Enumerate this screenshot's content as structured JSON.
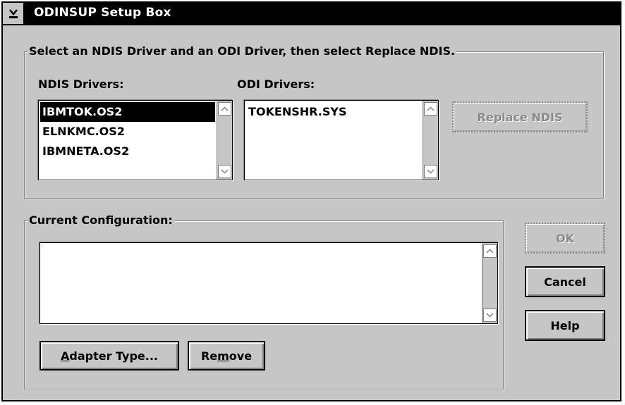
{
  "window": {
    "title": "ODINSUP Setup Box"
  },
  "driver_group": {
    "label": "Select an NDIS Driver and an ODI Driver, then select Replace NDIS.",
    "ndis_label": "NDIS Drivers:",
    "ndis_items": [
      "IBMTOK.OS2",
      "ELNKMC.OS2",
      "IBMNETA.OS2"
    ],
    "ndis_selected": "IBMTOK.OS2",
    "odi_label": "ODI Drivers:",
    "odi_items": [
      "TOKENSHR.SYS"
    ],
    "replace_button": {
      "pre": "",
      "mnemonic": "R",
      "post": "eplace NDIS",
      "enabled": false
    }
  },
  "config_group": {
    "label": "Current Configuration:",
    "items": [],
    "adapter_button": {
      "pre": "",
      "mnemonic": "A",
      "post": "dapter Type..."
    },
    "remove_button": {
      "pre": "Re",
      "mnemonic": "m",
      "post": "ove"
    }
  },
  "dialog_buttons": {
    "ok": {
      "label": "OK",
      "enabled": false
    },
    "cancel": {
      "label": "Cancel"
    },
    "help": {
      "label": "Help"
    }
  },
  "icons": {
    "system_menu": "system-menu-icon",
    "scroll_up": "scroll-up-arrow-icon",
    "scroll_down": "scroll-down-arrow-icon"
  },
  "colors": {
    "face": "#c6c6c6",
    "titlebar": "#000000",
    "selection": "#000000",
    "disabled_text": "#8a8a8a"
  }
}
